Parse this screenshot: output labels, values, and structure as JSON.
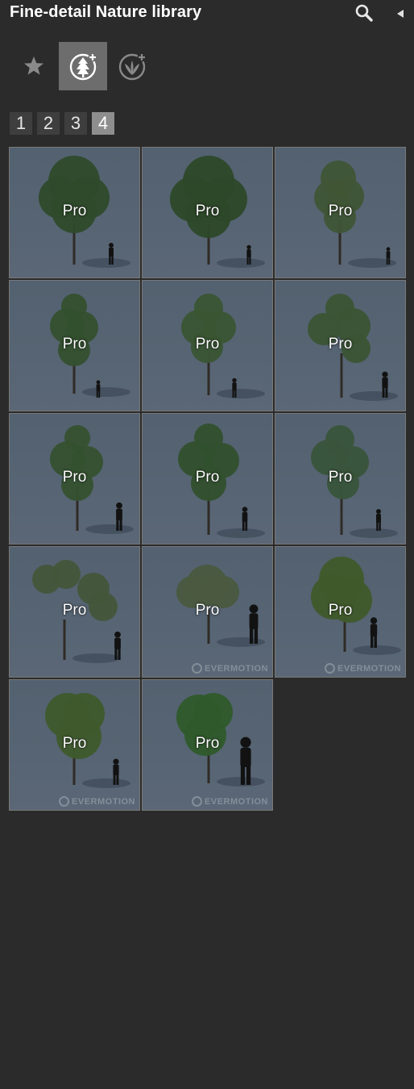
{
  "header": {
    "title": "Fine-detail Nature library",
    "search_icon": "search-icon",
    "collapse_icon": "collapse-arrow-icon"
  },
  "categories": [
    {
      "id": "favorites",
      "icon": "star-icon",
      "active": false
    },
    {
      "id": "trees",
      "icon": "tree-add-icon",
      "active": true
    },
    {
      "id": "plants",
      "icon": "plant-add-icon",
      "active": false
    }
  ],
  "pagination": {
    "pages": [
      "1",
      "2",
      "3",
      "4"
    ],
    "current": "4"
  },
  "tiles": [
    {
      "badge": "Pro",
      "watermark": ""
    },
    {
      "badge": "Pro",
      "watermark": ""
    },
    {
      "badge": "Pro",
      "watermark": ""
    },
    {
      "badge": "Pro",
      "watermark": ""
    },
    {
      "badge": "Pro",
      "watermark": ""
    },
    {
      "badge": "Pro",
      "watermark": ""
    },
    {
      "badge": "Pro",
      "watermark": ""
    },
    {
      "badge": "Pro",
      "watermark": ""
    },
    {
      "badge": "Pro",
      "watermark": ""
    },
    {
      "badge": "Pro",
      "watermark": ""
    },
    {
      "badge": "Pro",
      "watermark": "EVERMOTION"
    },
    {
      "badge": "Pro",
      "watermark": "EVERMOTION"
    },
    {
      "badge": "Pro",
      "watermark": "EVERMOTION"
    },
    {
      "badge": "Pro",
      "watermark": "EVERMOTION"
    }
  ],
  "colors": {
    "background": "#2b2b2b",
    "active_category": "#6d6d6d",
    "page_button": "#3e3e3e",
    "page_button_active": "#8e8e8e",
    "tile_border": "#787878"
  }
}
